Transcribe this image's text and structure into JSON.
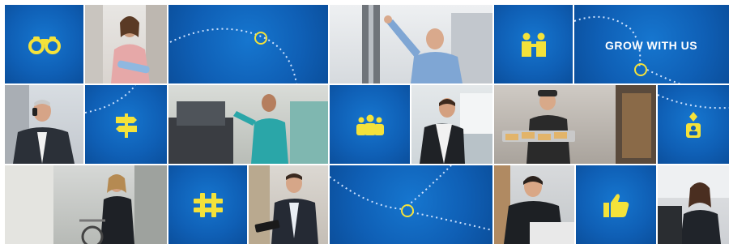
{
  "banner": {
    "headline": "GROW WITH US"
  },
  "colors": {
    "tile_blue": "#0f5fb5",
    "icon_yellow": "#f4e23a",
    "dotted_line": "#cfe3ff"
  },
  "tiles": [
    {
      "kind": "icon",
      "icon": "binoculars-icon"
    },
    {
      "kind": "photo",
      "subject": "woman-holding-rolled-paper"
    },
    {
      "kind": "path",
      "icon": "dotted-path-circle"
    },
    {
      "kind": "photo",
      "subject": "man-at-shelf"
    },
    {
      "kind": "icon",
      "icon": "two-people-icon"
    },
    {
      "kind": "text",
      "icon": "dotted-path-circle"
    },
    {
      "kind": "photo",
      "subject": "man-on-phone"
    },
    {
      "kind": "icon",
      "icon": "signpost-icon"
    },
    {
      "kind": "photo",
      "subject": "woman-with-cart"
    },
    {
      "kind": "icon",
      "icon": "group-icon"
    },
    {
      "kind": "photo",
      "subject": "man-at-counter"
    },
    {
      "kind": "photo",
      "subject": "baker-with-pastries"
    },
    {
      "kind": "icon",
      "icon": "person-pin-icon"
    },
    {
      "kind": "photo",
      "subject": "woman-with-bicycle"
    },
    {
      "kind": "icon",
      "icon": "hashtag-icon"
    },
    {
      "kind": "photo",
      "subject": "man-with-tablet"
    },
    {
      "kind": "path",
      "icon": "dotted-path-circle"
    },
    {
      "kind": "photo",
      "subject": "man-at-laptop"
    },
    {
      "kind": "icon",
      "icon": "thumbs-up-icon"
    },
    {
      "kind": "photo",
      "subject": "woman-at-desk"
    }
  ]
}
